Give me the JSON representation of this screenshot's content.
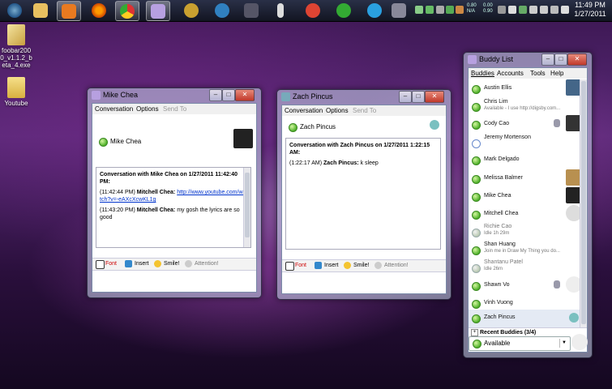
{
  "taskbar": {
    "clock_time": "11:49 PM",
    "clock_date": "1/27/2011",
    "tray_text_a": "0.80",
    "tray_text_b": "N/A",
    "tray_text_c": "0.00",
    "tray_text_d": "0.90"
  },
  "desktop": {
    "icon1_label": "foobar2000_v1.1.2_beta_4.exe",
    "icon2_label": "Youtube"
  },
  "chat_mike": {
    "title": "Mike Chea",
    "menu": [
      "Conversation",
      "Options",
      "Send To"
    ],
    "header_name": "Mike Chea",
    "log_heading": "Conversation with Mike Chea on 1/27/2011 11:42:40 PM:",
    "msg1_time": "(11:42:44 PM)",
    "msg1_sender": "Mitchell Chea:",
    "msg1_link": "http://www.youtube.com/watch?v=-eAXcXcwKL1g",
    "msg2_time": "(11:43:20 PM)",
    "msg2_sender": "Mitchell Chea:",
    "msg2_text": "my gosh the lyrics are so good",
    "toolbar": [
      "Font",
      "Insert",
      "Smile!",
      "Attention!"
    ]
  },
  "chat_zach": {
    "title": "Zach Pincus",
    "menu": [
      "Conversation",
      "Options",
      "Send To"
    ],
    "header_name": "Zach Pincus",
    "log_heading": "Conversation with Zach Pincus on 1/27/2011 1:22:15 AM:",
    "msg1_time": "(1:22:17 AM)",
    "msg1_sender": "Zach Pincus:",
    "msg1_text": "k sleep",
    "toolbar": [
      "Font",
      "Insert",
      "Smile!",
      "Attention!"
    ]
  },
  "buddy_list": {
    "title": "Buddy List",
    "menu": [
      "Buddies",
      "Accounts",
      "Tools",
      "Help"
    ],
    "buddies": [
      {
        "name": "Austin Ellis",
        "sub": ""
      },
      {
        "name": "Chris Lim",
        "sub": "Available - I use http://digsby.com..."
      },
      {
        "name": "Cody Cao",
        "sub": ""
      },
      {
        "name": "Jeremy Mortenson",
        "sub": ""
      },
      {
        "name": "Mark Delgado",
        "sub": ""
      },
      {
        "name": "Melissa Balmer",
        "sub": ""
      },
      {
        "name": "Mike Chea",
        "sub": ""
      },
      {
        "name": "Mitchell Chea",
        "sub": ""
      },
      {
        "name": "Richie Cao",
        "sub": "Idle 1h 29m"
      },
      {
        "name": "Shan Huang",
        "sub": "Join me in Draw My Thing you do..."
      },
      {
        "name": "Shantanu Patel",
        "sub": "Idle 26m"
      },
      {
        "name": "Shawn Vo",
        "sub": ""
      },
      {
        "name": "Vinh Vuong",
        "sub": ""
      },
      {
        "name": "Zach Pincus",
        "sub": ""
      }
    ],
    "recent_label": "Recent Buddies (3/4)",
    "status_value": "Available"
  }
}
